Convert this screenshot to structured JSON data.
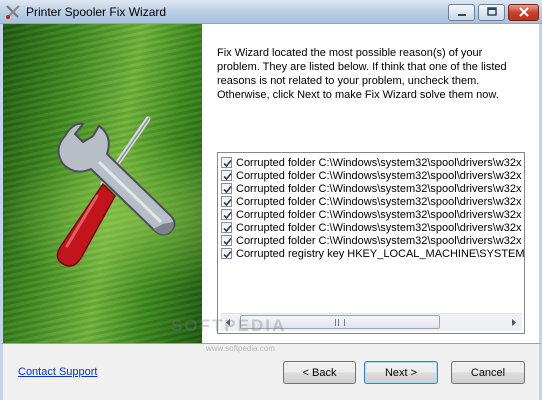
{
  "window": {
    "title": "Printer Spooler Fix Wizard",
    "app_icon": "wrench-screwdriver-icon"
  },
  "intro_text": "Fix Wizard located the most possible reason(s) of your problem. They are listed below. If think that one of the listed reasons is not related to your problem, uncheck them. Otherwise, click Next to make Fix Wizard solve them now.",
  "problems": [
    {
      "label": "Corrupted folder C:\\Windows\\system32\\spool\\drivers\\w32x",
      "checked": true
    },
    {
      "label": "Corrupted folder C:\\Windows\\system32\\spool\\drivers\\w32x",
      "checked": true
    },
    {
      "label": "Corrupted folder C:\\Windows\\system32\\spool\\drivers\\w32x",
      "checked": true
    },
    {
      "label": "Corrupted folder C:\\Windows\\system32\\spool\\drivers\\w32x",
      "checked": true
    },
    {
      "label": "Corrupted folder C:\\Windows\\system32\\spool\\drivers\\w32x",
      "checked": true
    },
    {
      "label": "Corrupted folder C:\\Windows\\system32\\spool\\drivers\\w32x",
      "checked": true
    },
    {
      "label": "Corrupted folder C:\\Windows\\system32\\spool\\drivers\\w32x",
      "checked": true
    },
    {
      "label": "Corrupted registry key HKEY_LOCAL_MACHINE\\SYSTEM\\Cur",
      "checked": true
    }
  ],
  "footer": {
    "contact_label": "Contact Support",
    "back_label": "< Back",
    "next_label": "Next >",
    "cancel_label": "Cancel"
  },
  "watermark": {
    "text": "SOFTPEDIA",
    "url": "www.softpedia.com"
  },
  "colors": {
    "link": "#0033cc",
    "side_green": "#3f8a1f",
    "close_button": "#c5422d"
  }
}
